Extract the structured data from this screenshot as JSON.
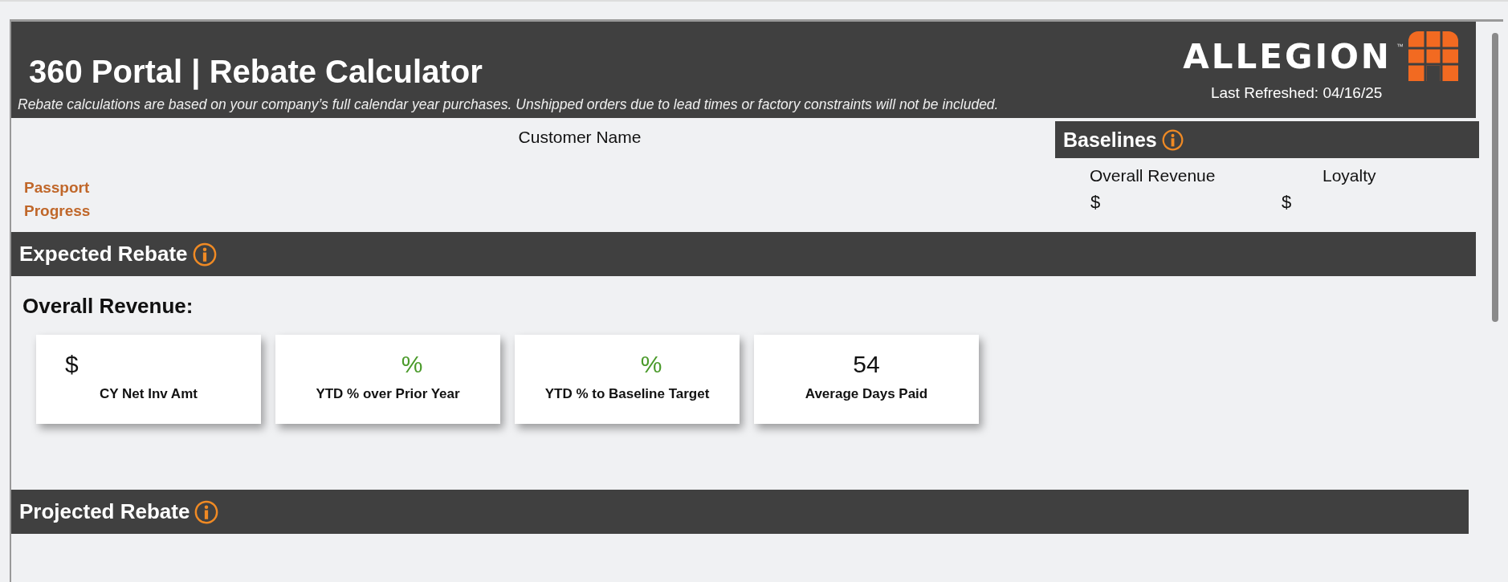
{
  "header": {
    "title": "360 Portal | Rebate Calculator",
    "subtitle": "Rebate calculations are based on your company’s full calendar year purchases. Unshipped orders due to lead times or factory constraints will not be included.",
    "logo": {
      "wordmark": "ALLEGION",
      "trademark": "™"
    },
    "last_refreshed": "Last Refreshed: 04/16/25"
  },
  "customer": {
    "label": "Customer Name"
  },
  "passport": {
    "label": "Passport Progress"
  },
  "baselines": {
    "title": "Baselines",
    "columns": [
      {
        "label": "Overall Revenue",
        "value": "$"
      },
      {
        "label": "Loyalty",
        "value": "$"
      }
    ]
  },
  "expected_rebate": {
    "title": "Expected Rebate",
    "subheading": "Overall Revenue:",
    "cards": [
      {
        "kind": "currency",
        "value": "$",
        "label": "CY Net Inv Amt"
      },
      {
        "kind": "percent",
        "value": "%",
        "label": "YTD % over Prior Year"
      },
      {
        "kind": "percent",
        "value": "%",
        "label": "YTD % to Baseline Target"
      },
      {
        "kind": "number",
        "value": "54",
        "label": "Average Days Paid"
      }
    ]
  },
  "projected_rebate": {
    "title": "Projected Rebate"
  }
}
